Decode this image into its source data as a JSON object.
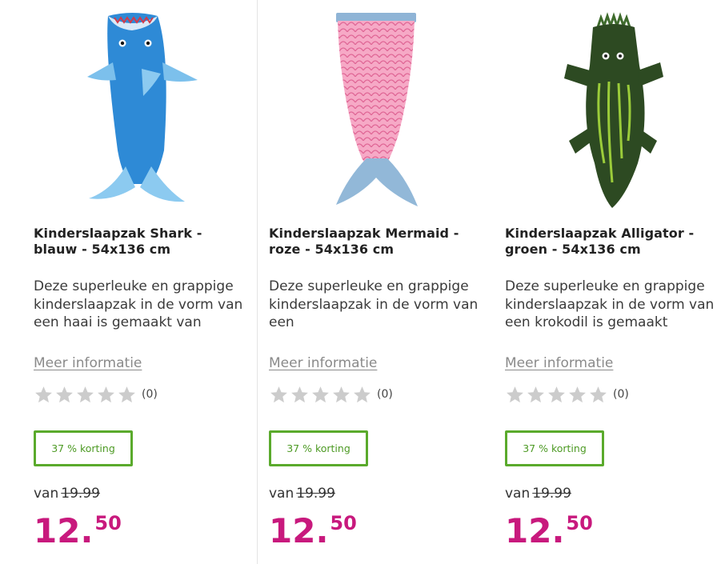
{
  "products": [
    {
      "title": "Kinderslaapzak Shark - blauw - 54x136 cm",
      "description": "Deze superleuke en grappige kinderslaapzak in de vorm van een haai is gemaakt van",
      "more_link": "Meer informatie",
      "rating_count": "(0)",
      "stars_filled": 0,
      "discount_badge": "37 % korting",
      "old_price_prefix": "van",
      "old_price": "19.99",
      "price_int": "12",
      "price_sep": ".",
      "price_cents": "50",
      "image_icon": "shark-sleeping-bag-image"
    },
    {
      "title": "Kinderslaapzak Mermaid - roze - 54x136 cm",
      "description": "Deze superleuke en grappige kinderslaapzak in de vorm van een",
      "more_link": "Meer informatie",
      "rating_count": "(0)",
      "stars_filled": 0,
      "discount_badge": "37 % korting",
      "old_price_prefix": "van",
      "old_price": "19.99",
      "price_int": "12",
      "price_sep": ".",
      "price_cents": "50",
      "image_icon": "mermaid-sleeping-bag-image"
    },
    {
      "title": "Kinderslaapzak Alligator - groen - 54x136 cm",
      "description": "Deze superleuke en grappige kinderslaapzak in de vorm van een krokodil is gemaakt",
      "more_link": "Meer informatie",
      "rating_count": "(0)",
      "stars_filled": 0,
      "discount_badge": "37 % korting",
      "old_price_prefix": "van",
      "old_price": "19.99",
      "price_int": "12",
      "price_sep": ".",
      "price_cents": "50",
      "image_icon": "alligator-sleeping-bag-image"
    }
  ],
  "colors": {
    "price": "#c8197d",
    "badge": "#5aaa2c",
    "star_empty": "#cccccc",
    "link": "#8a8a8a"
  }
}
